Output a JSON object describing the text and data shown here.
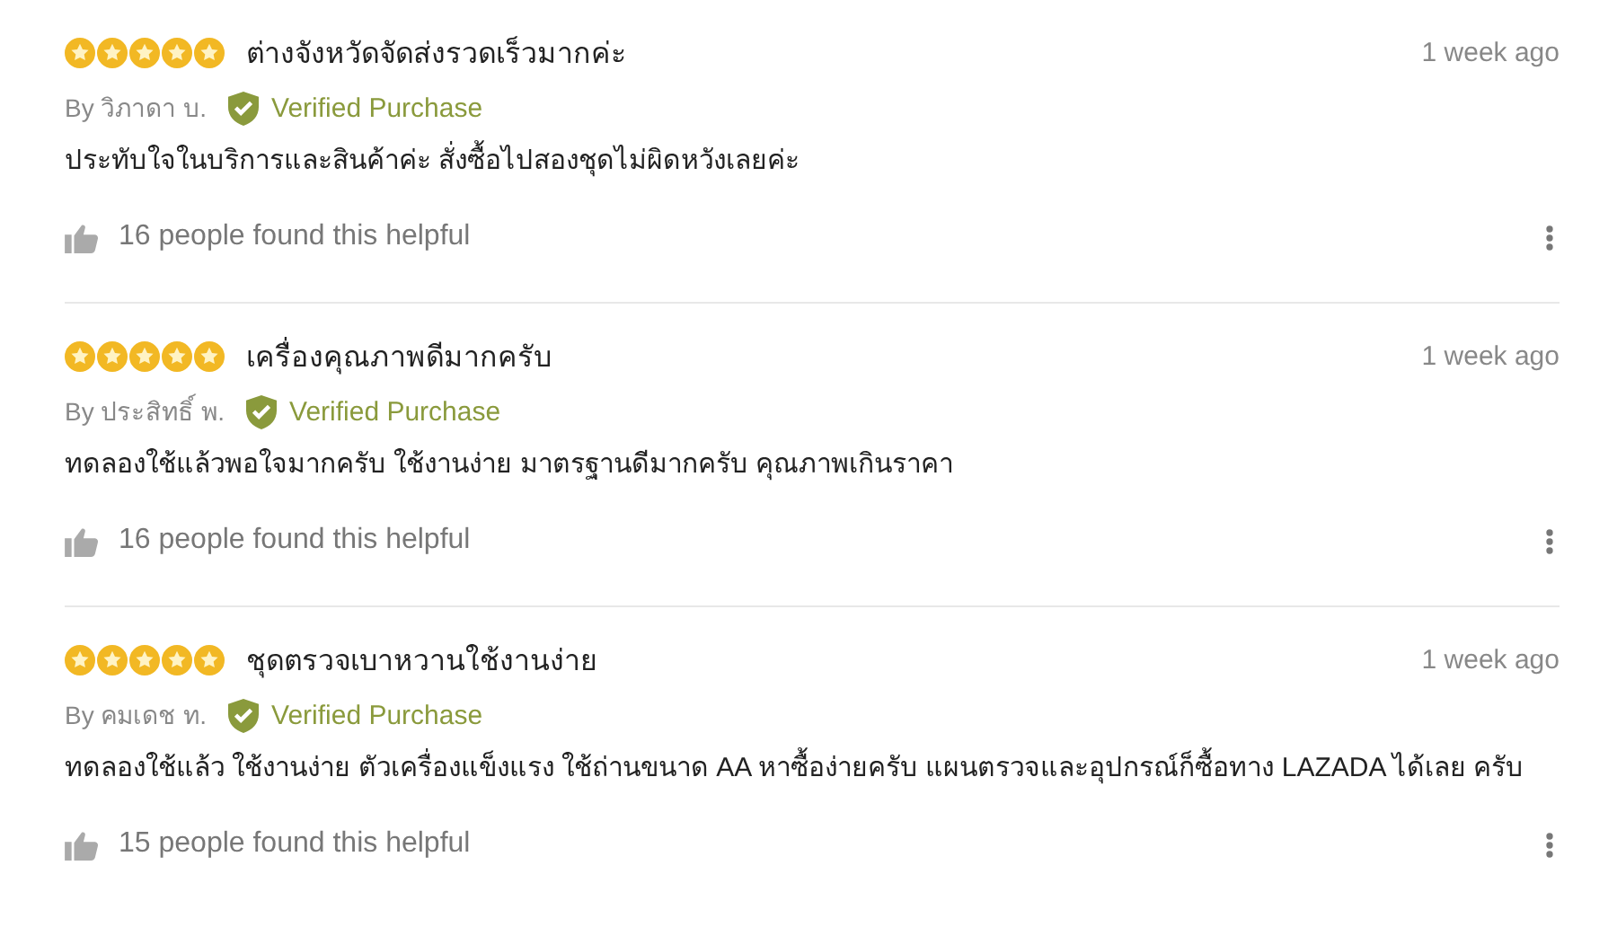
{
  "reviews": [
    {
      "stars": 5,
      "title": "ต่างจังหวัดจัดส่งรวดเร็วมากค่ะ",
      "time": "1 week ago",
      "author": "By วิภาดา บ.",
      "verified": true,
      "badge": "Verified Purchase",
      "body": "ประทับใจในบริการและสินค้าค่ะ สั่งซื้อไปสองชุดไม่ผิดหวังเลยค่ะ",
      "helpful": "16 people found this helpful"
    },
    {
      "stars": 5,
      "title": "เครื่องคุณภาพดีมากครับ",
      "time": "1 week ago",
      "author": "By ประสิทธิ์ พ.",
      "verified": true,
      "badge": "Verified Purchase",
      "body": "ทดลองใช้แล้วพอใจมากครับ ใช้งานง่าย มาตรฐานดีมากครับ คุณภาพเกินราคา",
      "helpful": "16 people found this helpful"
    },
    {
      "stars": 5,
      "title": "ชุดตรวจเบาหวานใช้งานง่าย",
      "time": "1 week ago",
      "author": "By คมเดช ท.",
      "verified": true,
      "badge": "Verified Purchase",
      "body": "ทดลองใช้แล้ว ใช้งานง่าย ตัวเครื่องแข็งแรง ใช้ถ่านขนาด AA หาซื้อง่ายครับ แผนตรวจและอุปกรณ์ก็ซื้อทาง LAZADA ได้เลย ครับ",
      "helpful": "15 people found this helpful"
    }
  ]
}
